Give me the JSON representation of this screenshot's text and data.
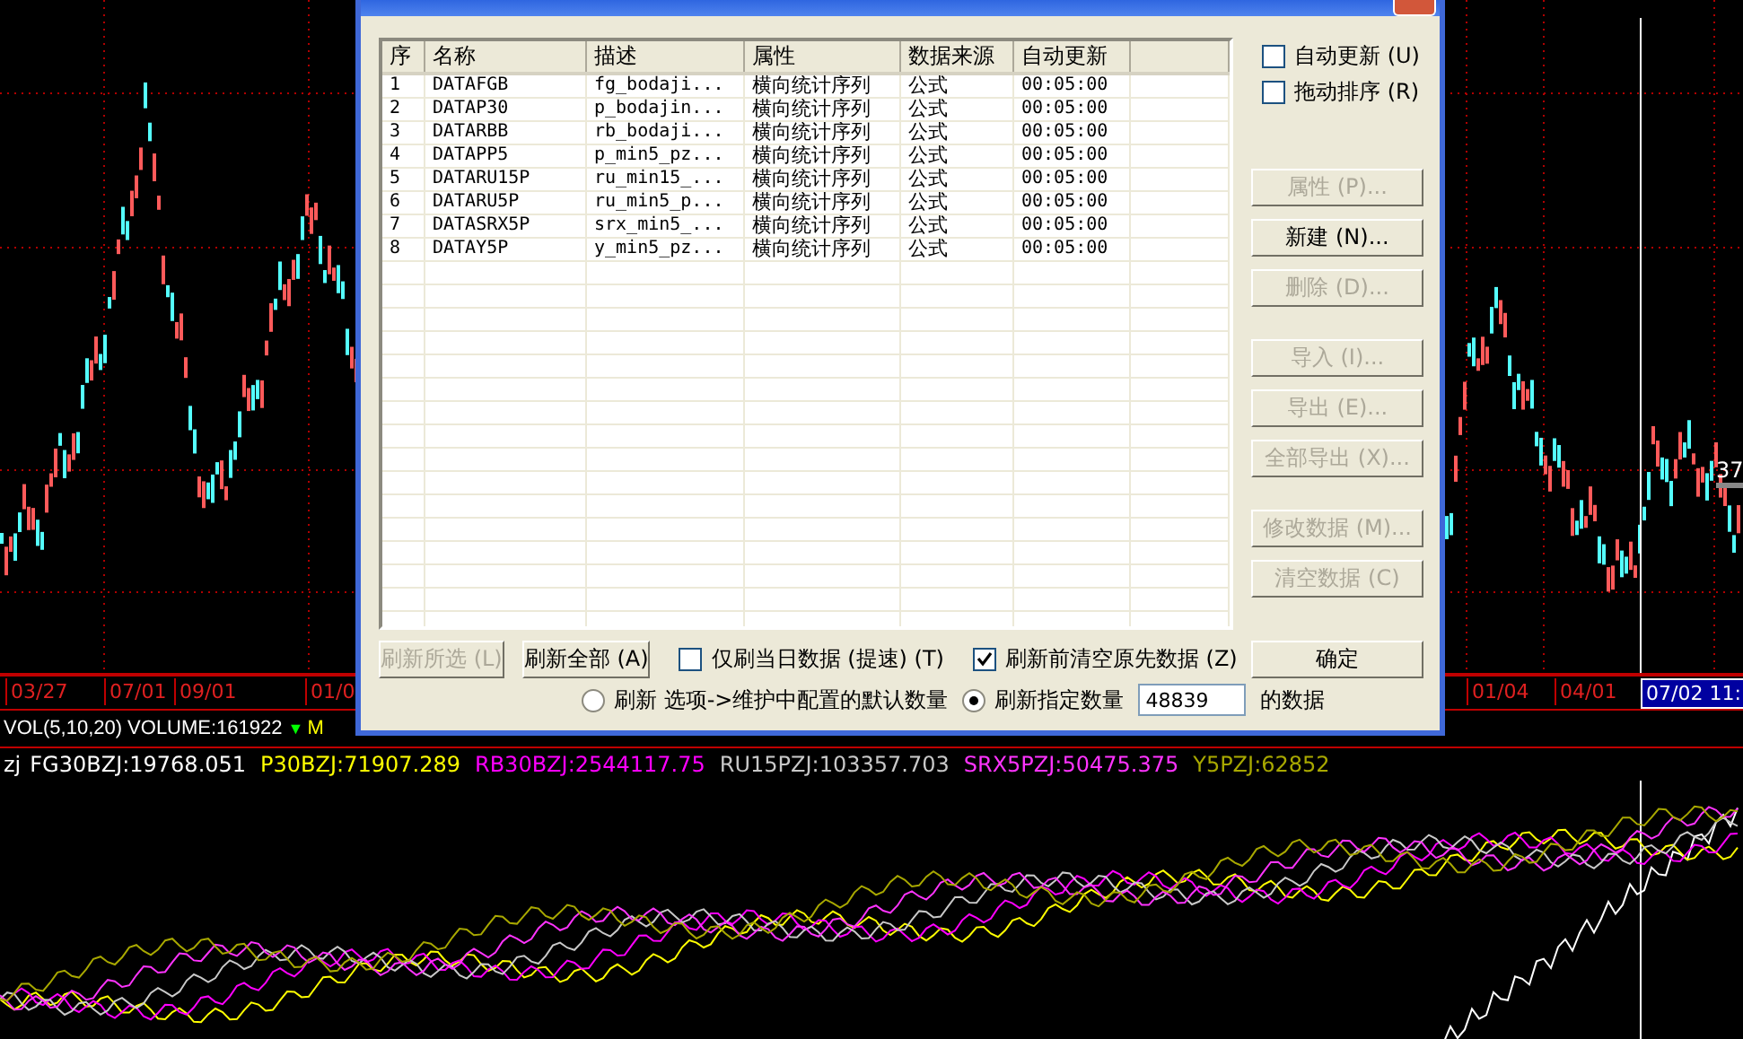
{
  "main_chart": {
    "price_label": "37"
  },
  "date_axis": [
    {
      "label": "03/27",
      "selected": false
    },
    {
      "label": "07/01",
      "selected": false
    },
    {
      "label": "09/01",
      "selected": false
    },
    {
      "label": "01/0",
      "selected": false
    },
    {
      "label": "01/04",
      "selected": false
    },
    {
      "label": "04/01",
      "selected": false
    },
    {
      "label": "07/02 11:",
      "selected": true
    }
  ],
  "volume_bar": {
    "title": "VOL(5,10,20)",
    "volume": "VOLUME:161922",
    "marker": "▼",
    "next": "M"
  },
  "indicator": {
    "name": "zj",
    "series": [
      {
        "label": "FG30BZJ:19768.051",
        "color": "#ffffff"
      },
      {
        "label": "P30BZJ:71907.289",
        "color": "#ffff00"
      },
      {
        "label": "RB30BZJ:2544117.75",
        "color": "#ff00ff"
      },
      {
        "label": "RU15PZJ:103357.703",
        "color": "#c8c8c8"
      },
      {
        "label": "SRX5PZJ:50475.375",
        "color": "#ff33ff"
      },
      {
        "label": "Y5PZJ:62852",
        "color": "#a8a800"
      }
    ]
  },
  "dialog": {
    "table": {
      "columns": [
        "序",
        "名称",
        "描述",
        "属性",
        "数据来源",
        "自动更新"
      ],
      "rows": [
        [
          "1",
          "DATAFGB",
          "fg_bodaji...",
          "横向统计序列",
          "公式",
          "00:05:00"
        ],
        [
          "2",
          "DATAP30",
          "p_bodajin...",
          "横向统计序列",
          "公式",
          "00:05:00"
        ],
        [
          "3",
          "DATARBB",
          "rb_bodaji...",
          "横向统计序列",
          "公式",
          "00:05:00"
        ],
        [
          "4",
          "DATAPP5",
          "p_min5_pz...",
          "横向统计序列",
          "公式",
          "00:05:00"
        ],
        [
          "5",
          "DATARU15P",
          "ru_min15_...",
          "横向统计序列",
          "公式",
          "00:05:00"
        ],
        [
          "6",
          "DATARU5P",
          "ru_min5_p...",
          "横向统计序列",
          "公式",
          "00:05:00"
        ],
        [
          "7",
          "DATASRX5P",
          "srx_min5_...",
          "横向统计序列",
          "公式",
          "00:05:00"
        ],
        [
          "8",
          "DATAY5P",
          "y_min5_pz...",
          "横向统计序列",
          "公式",
          "00:05:00"
        ]
      ]
    },
    "options": [
      {
        "label": "自动更新 (U)",
        "checked": false
      },
      {
        "label": "拖动排序 (R)",
        "checked": false
      }
    ],
    "side_button_groups": [
      [
        {
          "label": "属性 (P)...",
          "disabled": true
        },
        {
          "label": "新建 (N)...",
          "disabled": false
        },
        {
          "label": "删除 (D)...",
          "disabled": true
        }
      ],
      [
        {
          "label": "导入 (I)...",
          "disabled": true
        },
        {
          "label": "导出 (E)...",
          "disabled": true
        },
        {
          "label": "全部导出 (X)...",
          "disabled": true
        }
      ],
      [
        {
          "label": "修改数据 (M)...",
          "disabled": true
        },
        {
          "label": "清空数据 (C)",
          "disabled": true
        }
      ]
    ],
    "bottom_buttons": [
      {
        "label": "刷新所选 (L)",
        "disabled": true
      },
      {
        "label": "刷新全部 (A)",
        "disabled": false
      }
    ],
    "bottom_checks": [
      {
        "label": "仅刷当日数据 (提速) (T)",
        "checked": false
      },
      {
        "label": "刷新前清空原先数据 (Z)",
        "checked": true
      }
    ],
    "ok_button": "确定",
    "radios": [
      {
        "label": "刷新 选项->维护中配置的默认数量",
        "selected": false
      },
      {
        "label": "刷新指定数量",
        "selected": true
      }
    ],
    "count_value": "48839",
    "count_suffix": "的数据"
  }
}
